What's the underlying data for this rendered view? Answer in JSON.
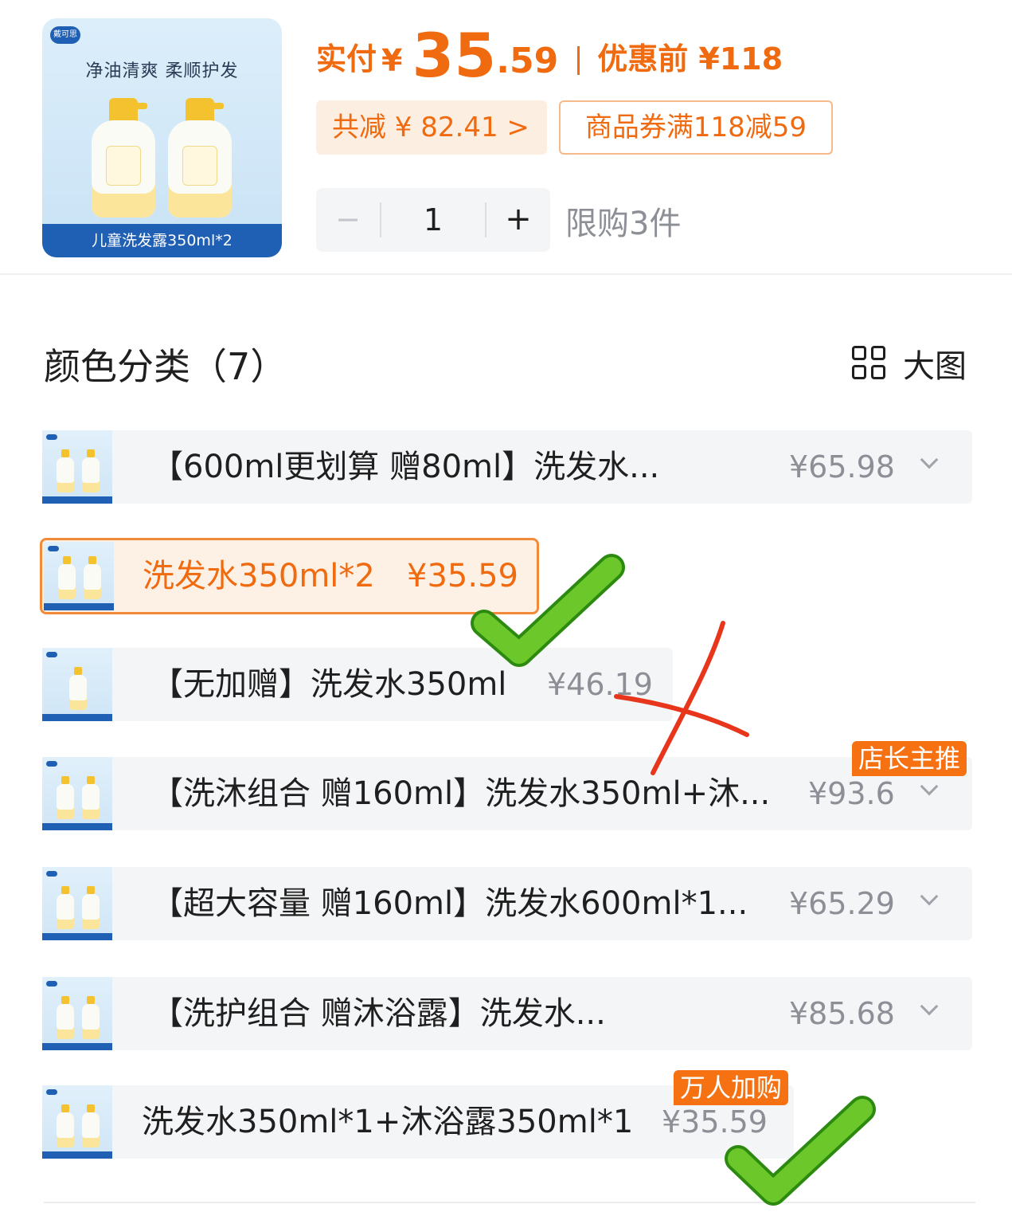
{
  "product": {
    "brand": "戴可思",
    "tagline": "净油清爽 柔顺护发",
    "caption": "儿童洗发露350ml*2"
  },
  "price": {
    "paid_label": "实付",
    "currency": "¥",
    "paid_int": "35",
    "paid_dec": ".59",
    "original": "优惠前 ¥118",
    "accent_color": "#f06a0f"
  },
  "discount_chip": "共减 ¥ 82.41 >",
  "coupon_chip": "商品券满118减59",
  "stepper": {
    "minus": "−",
    "qty": "1",
    "plus": "+"
  },
  "limit_text": "限购3件",
  "section": {
    "title": "颜色分类（7）",
    "big_view_icon": "grid-icon",
    "big_view_label": "大图"
  },
  "options": [
    {
      "label": "【600ml更划算 赠80ml】洗发水...",
      "price": "¥65.98"
    },
    {
      "label": "洗发水350ml*2",
      "price": "¥35.59"
    },
    {
      "label": "【无加赠】洗发水350ml",
      "price": "¥46.19"
    },
    {
      "label": "【洗沐组合 赠160ml】洗发水350ml+沐...",
      "price": "¥93.6",
      "badge": "店长主推"
    },
    {
      "label": "【超大容量 赠160ml】洗发水600ml*1...",
      "price": "¥65.29"
    },
    {
      "label": "【洗护组合 赠沐浴露】洗发水...",
      "price": "¥85.68"
    },
    {
      "label": "洗发水350ml*1+沐浴露350ml*1",
      "price": "¥35.59",
      "badge": "万人加购"
    }
  ],
  "selected_index": 1,
  "annotations": {
    "check_color": "#4caf1a",
    "cross_color": "#e8361c"
  }
}
